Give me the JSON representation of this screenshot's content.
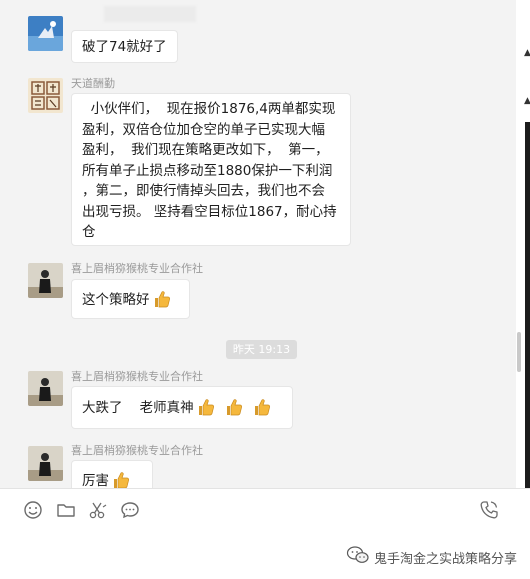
{
  "chat": {
    "messages": [
      {
        "sender": "",
        "text": "破了74就好了",
        "emoji_count": 0
      },
      {
        "sender": "天道酬勤",
        "lines": [
          "  小伙伴们，  现在报价1876,4两单都实现",
          "盈利，双倍仓位加仓空的单子已实现大幅",
          "盈利，  我们现在策略更改如下，  第一，",
          "所有单子止损点移动至1880保护一下利润",
          "，第二，即使行情掉头回去，我们也不会",
          "出现亏损。 坚持看空目标位1867，耐心持",
          "仓"
        ]
      },
      {
        "sender": "喜上眉梢猕猴桃专业合作社",
        "text": "这个策略好",
        "emoji_count": 1
      },
      {
        "timestamp": "昨天 19:13"
      },
      {
        "sender": "喜上眉梢猕猴桃专业合作社",
        "text": "大跌了    老师真神",
        "emoji_count": 3
      },
      {
        "sender": "喜上眉梢猕猴桃专业合作社",
        "text": "厉害",
        "emoji_count": 1
      }
    ]
  },
  "toolbar": {
    "icons": [
      "emoji-icon",
      "folder-icon",
      "scissors-icon",
      "chat-history-icon",
      "phone-icon"
    ]
  },
  "watermark": {
    "text": "鬼手淘金之实战策略分享"
  },
  "colors": {
    "background": "#f3f3f3",
    "bubble": "#ffffff",
    "sender_text": "#9a9a9a",
    "timestamp_bg": "#dcdcdc"
  }
}
